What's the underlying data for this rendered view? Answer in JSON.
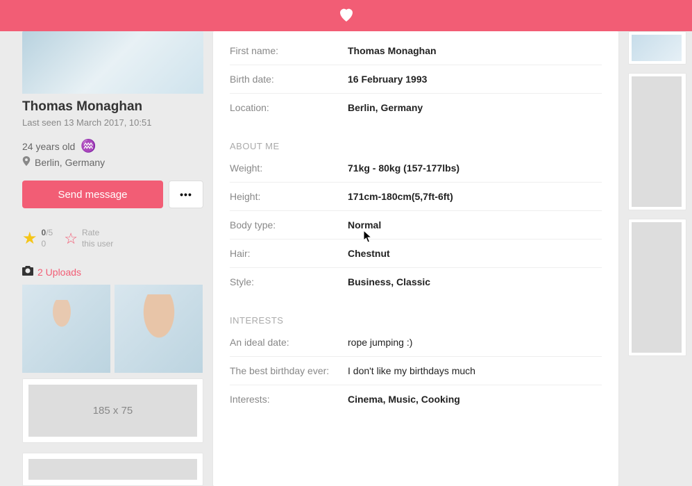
{
  "header": {},
  "sidebar": {
    "name": "Thomas Monaghan",
    "last_seen": "Last seen 13 March 2017, 10:51",
    "age": "24 years old",
    "location": "Berlin, Germany",
    "send_label": "Send message",
    "more_label": "•••",
    "rating_value": "0",
    "rating_out_of": "/5",
    "rating_count": "0",
    "rate_line1": "Rate",
    "rate_line2": "this user",
    "uploads_text": "2 Uploads",
    "ad1": "185 x 75"
  },
  "basics": [
    {
      "label": "First name:",
      "value": "Thomas Monaghan"
    },
    {
      "label": "Birth date:",
      "value": "16 February 1993"
    },
    {
      "label": "Location:",
      "value": "Berlin, Germany"
    }
  ],
  "sections": {
    "about_title": "ABOUT ME",
    "interests_title": "INTERESTS"
  },
  "about": [
    {
      "label": "Weight:",
      "value": "71kg - 80kg (157-177lbs)"
    },
    {
      "label": "Height:",
      "value": "171cm-180cm(5,7ft-6ft)"
    },
    {
      "label": "Body type:",
      "value": "Normal"
    },
    {
      "label": "Hair:",
      "value": "Chestnut"
    },
    {
      "label": "Style:",
      "value": "Business, Classic"
    }
  ],
  "interests": [
    {
      "label": "An ideal date:",
      "value": "rope jumping :)"
    },
    {
      "label": "The best birthday ever:",
      "value": "I don't like my birthdays much"
    },
    {
      "label": "Interests:",
      "value": "Cinema, Music, Cooking"
    }
  ]
}
